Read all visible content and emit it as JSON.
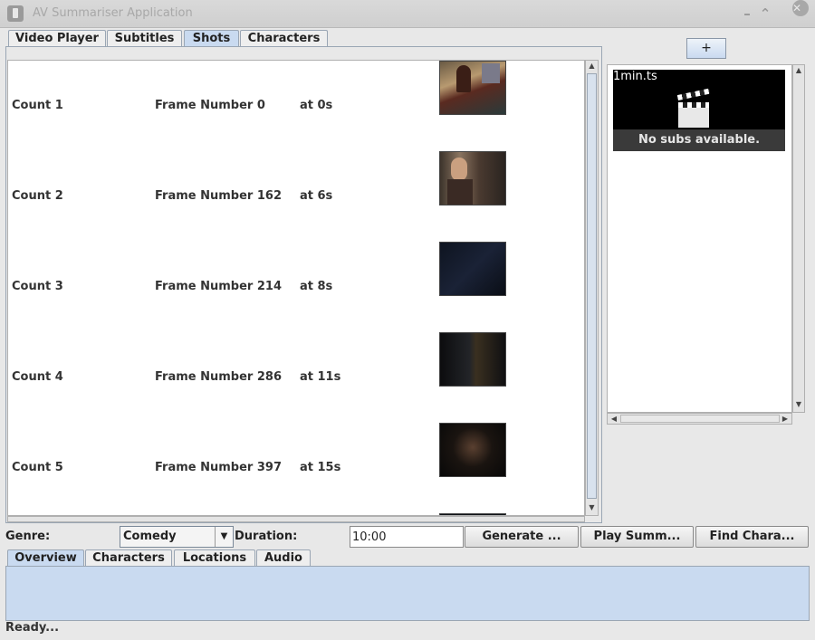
{
  "window": {
    "title": "AV Summariser Application"
  },
  "top_tabs": [
    {
      "label": "Video Player"
    },
    {
      "label": "Subtitles"
    },
    {
      "label": "Shots",
      "selected": true
    },
    {
      "label": "Characters"
    }
  ],
  "shots": [
    {
      "count": "Count 1",
      "frame": "Frame Number 0",
      "time": "at 0s"
    },
    {
      "count": "Count 2",
      "frame": "Frame Number 162",
      "time": "at 6s"
    },
    {
      "count": "Count 3",
      "frame": "Frame Number 214",
      "time": "at 8s"
    },
    {
      "count": "Count 4",
      "frame": "Frame Number 286",
      "time": "at 11s"
    },
    {
      "count": "Count 5",
      "frame": "Frame Number 397",
      "time": "at 15s"
    }
  ],
  "right_panel": {
    "add_label": "+",
    "video": {
      "name": "1min.ts",
      "no_subs": "No subs available."
    }
  },
  "controls": {
    "genre_label": "Genre:",
    "genre_value": "Comedy",
    "duration_label": "Duration:",
    "duration_value": "10:00",
    "generate_label": "Generate ...",
    "play_label": "Play Summ...",
    "find_label": "Find Chara..."
  },
  "bottom_tabs": [
    {
      "label": "Overview",
      "selected": true
    },
    {
      "label": "Characters"
    },
    {
      "label": "Locations"
    },
    {
      "label": "Audio"
    }
  ],
  "status": "Ready...",
  "colors": {
    "selected_tab": "#c9daf0",
    "panel_bg": "#e8e8e8"
  }
}
